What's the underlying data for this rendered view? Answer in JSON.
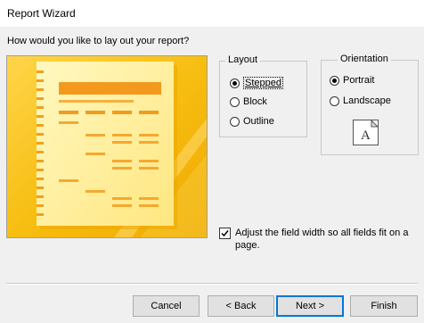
{
  "window": {
    "title": "Report Wizard"
  },
  "prompt": "How would you like to lay out your report?",
  "layout": {
    "legend": "Layout",
    "options": [
      {
        "label": "Stepped",
        "selected": true
      },
      {
        "label": "Block",
        "selected": false
      },
      {
        "label": "Outline",
        "selected": false
      }
    ]
  },
  "orientation": {
    "legend": "Orientation",
    "options": [
      {
        "label": "Portrait",
        "selected": true
      },
      {
        "label": "Landscape",
        "selected": false
      }
    ],
    "icon_letter": "A"
  },
  "adjust_width": {
    "label": "Adjust the field width so all fields fit on a page.",
    "checked": true
  },
  "buttons": {
    "cancel": "Cancel",
    "back": "< Back",
    "next": "Next >",
    "finish": "Finish"
  },
  "colors": {
    "accent": "#0078d7",
    "preview_gold": "#f5b800",
    "preview_paper": "#fff3a6",
    "preview_bar": "#f39a1e"
  }
}
